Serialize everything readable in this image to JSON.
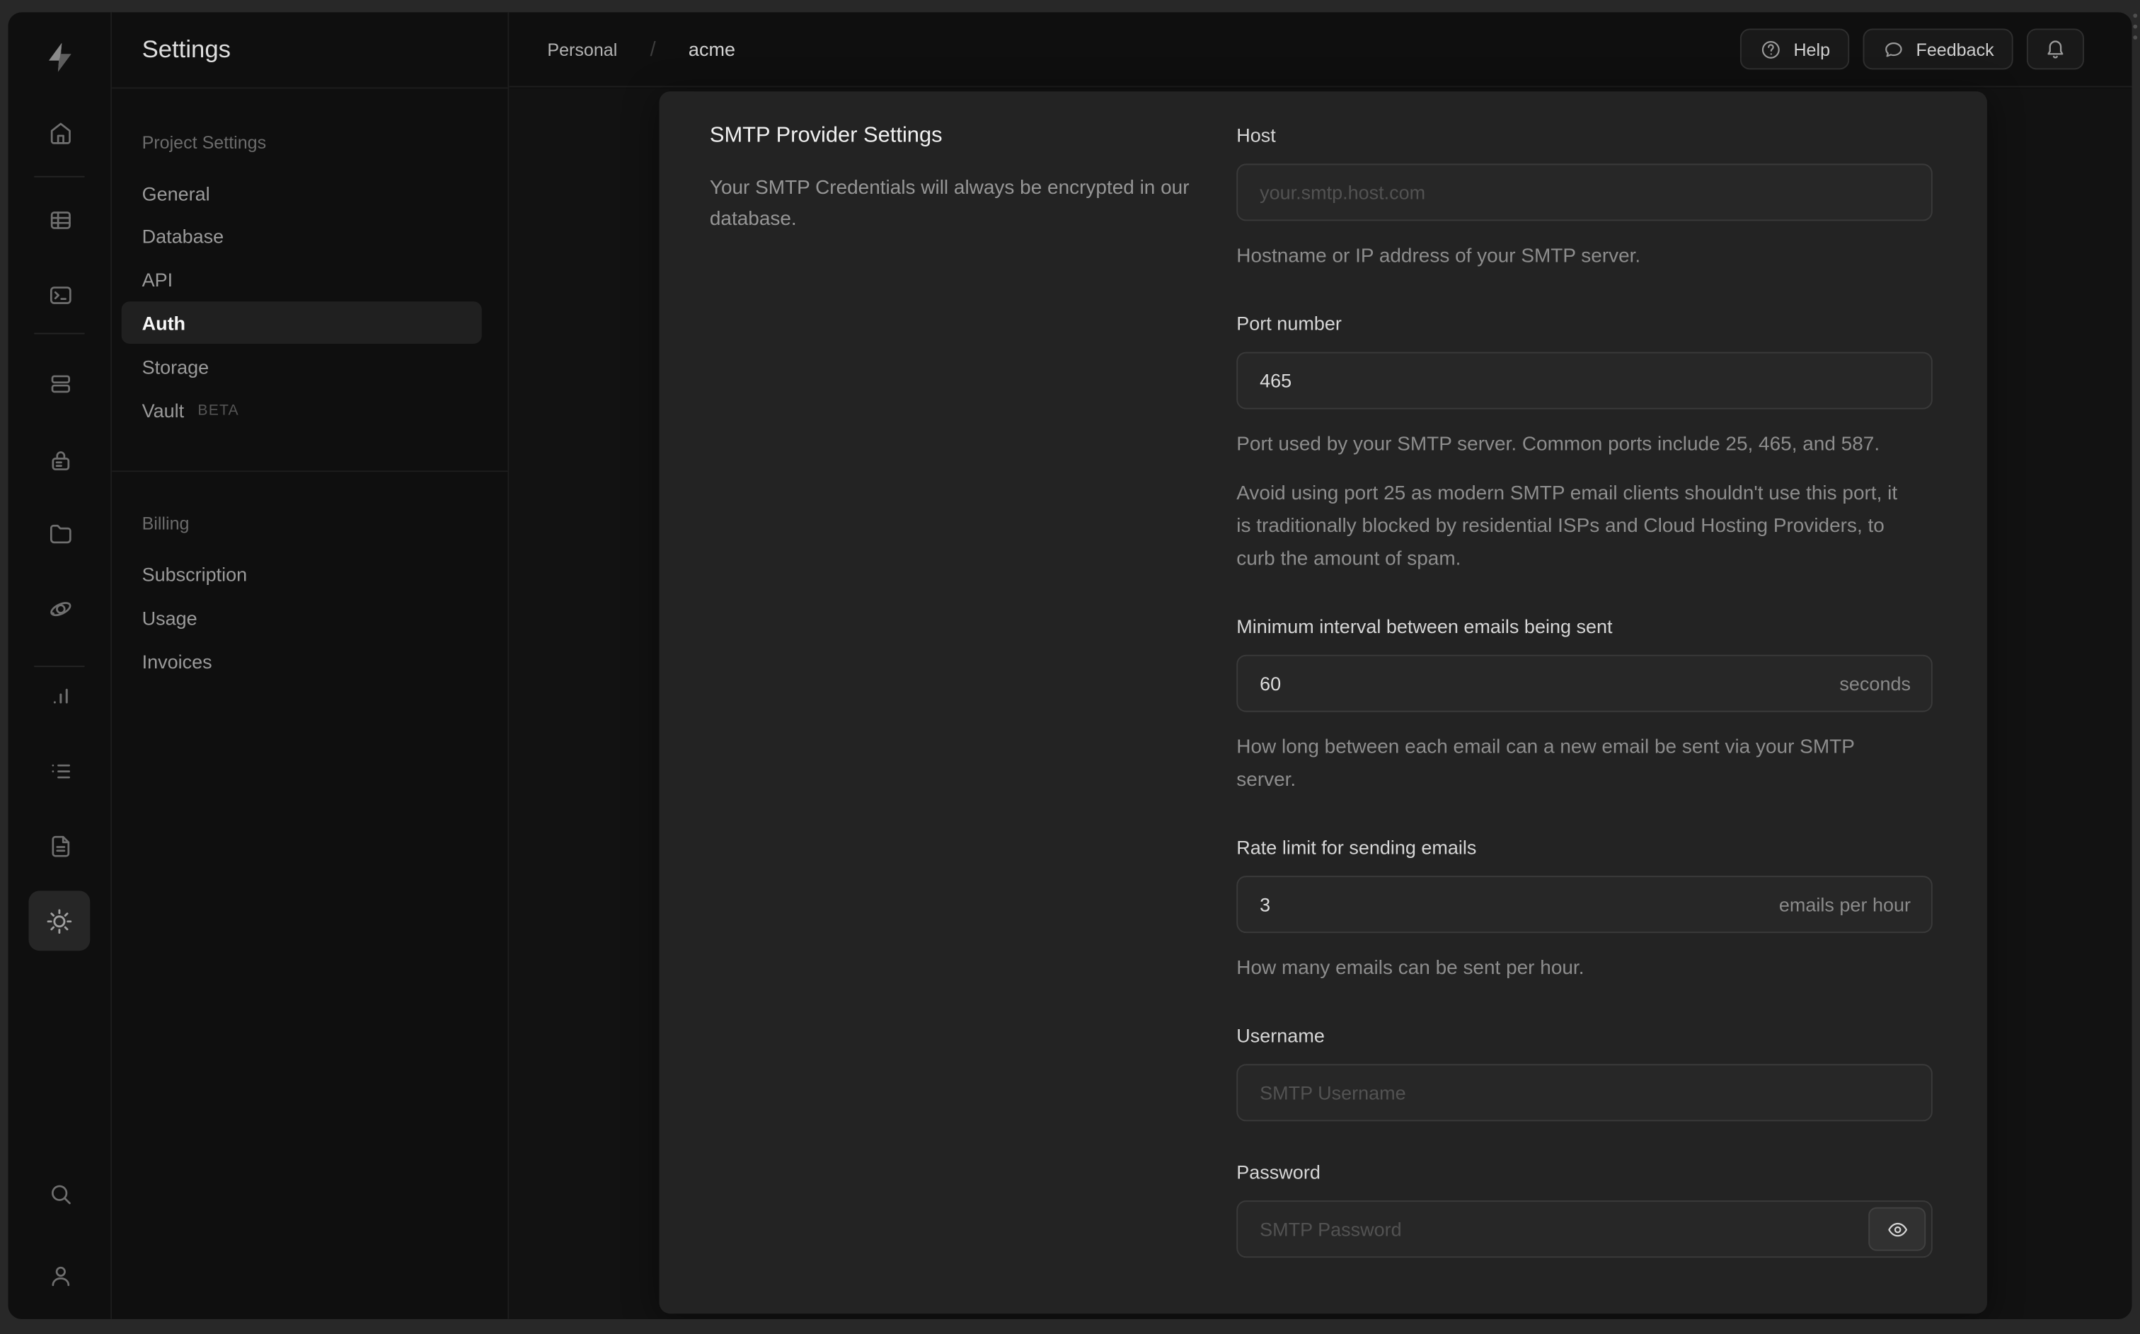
{
  "colors": {
    "page_bg": "#0f0f0f",
    "main_bg": "#121212",
    "card_bg": "#232323",
    "input_bg": "#272727",
    "input_border": "#3a3a3a",
    "text_primary": "#f0f0f0",
    "text_muted": "#8d8d8d"
  },
  "rail": {
    "icons": [
      "home",
      "table-editor",
      "sql-editor",
      "database",
      "auth",
      "storage",
      "edge-functions",
      "reports",
      "logs",
      "docs",
      "settings",
      "search",
      "user"
    ],
    "active": "settings"
  },
  "sidebar": {
    "title": "Settings",
    "sections": [
      {
        "label": "Project Settings",
        "items": [
          {
            "label": "General"
          },
          {
            "label": "Database"
          },
          {
            "label": "API"
          },
          {
            "label": "Auth",
            "active": true
          },
          {
            "label": "Storage"
          },
          {
            "label": "Vault",
            "badge": "BETA"
          }
        ]
      },
      {
        "label": "Billing",
        "items": [
          {
            "label": "Subscription"
          },
          {
            "label": "Usage"
          },
          {
            "label": "Invoices"
          }
        ]
      }
    ]
  },
  "topbar": {
    "breadcrumb": {
      "org": "Personal",
      "separator": "/",
      "project": "acme"
    },
    "help_label": "Help",
    "feedback_label": "Feedback"
  },
  "card": {
    "title": "SMTP Provider Settings",
    "description": "Your SMTP Credentials will always be encrypted in our database.",
    "fields": {
      "host": {
        "label": "Host",
        "placeholder": "your.smtp.host.com",
        "helper": "Hostname or IP address of your SMTP server."
      },
      "port": {
        "label": "Port number",
        "value": "465",
        "helper": "Port used by your SMTP server. Common ports include 25, 465, and 587.",
        "note": "Avoid using port 25 as modern SMTP email clients shouldn't use this port, it is traditionally blocked by residential ISPs and Cloud Hosting Providers, to curb the amount of spam."
      },
      "interval": {
        "label": "Minimum interval between emails being sent",
        "value": "60",
        "suffix": "seconds",
        "helper": "How long between each email can a new email be sent via your SMTP server."
      },
      "rate": {
        "label": "Rate limit for sending emails",
        "value": "3",
        "suffix": "emails per hour",
        "helper": "How many emails can be sent per hour."
      },
      "username": {
        "label": "Username",
        "placeholder": "SMTP Username"
      },
      "password": {
        "label": "Password",
        "placeholder": "SMTP Password"
      }
    }
  }
}
